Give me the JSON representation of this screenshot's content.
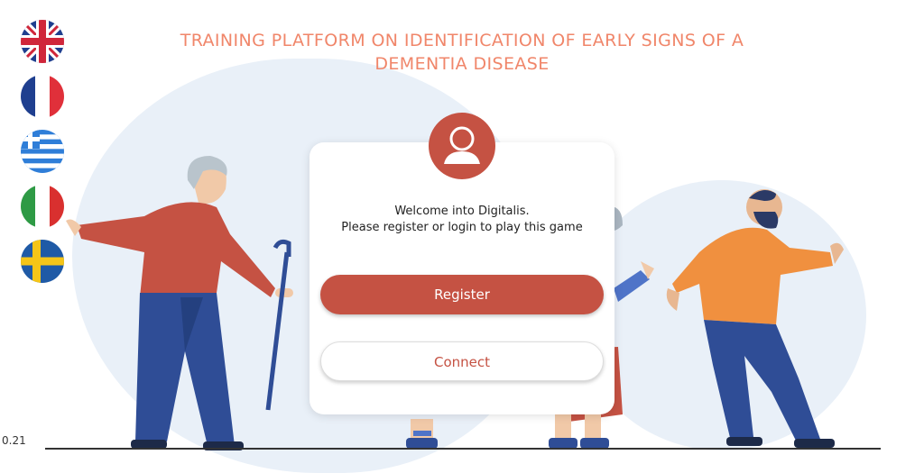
{
  "title": "TRAINING PLATFORM ON IDENTIFICATION OF EARLY SIGNS OF A\nDEMENTIA DISEASE",
  "languages": [
    {
      "name": "uk-flag-icon"
    },
    {
      "name": "france-flag-icon"
    },
    {
      "name": "greece-flag-icon"
    },
    {
      "name": "italy-flag-icon"
    },
    {
      "name": "sweden-flag-icon"
    }
  ],
  "card": {
    "avatar_icon": "user-avatar-icon",
    "welcome_line1": "Welcome into Digitalis.",
    "welcome_line2": "Please register or login to play this game",
    "register_label": "Register",
    "connect_label": "Connect"
  },
  "version": "0.21",
  "colors": {
    "accent": "#c55243",
    "title": "#f0866a",
    "background_blob": "#e9f0f8"
  }
}
